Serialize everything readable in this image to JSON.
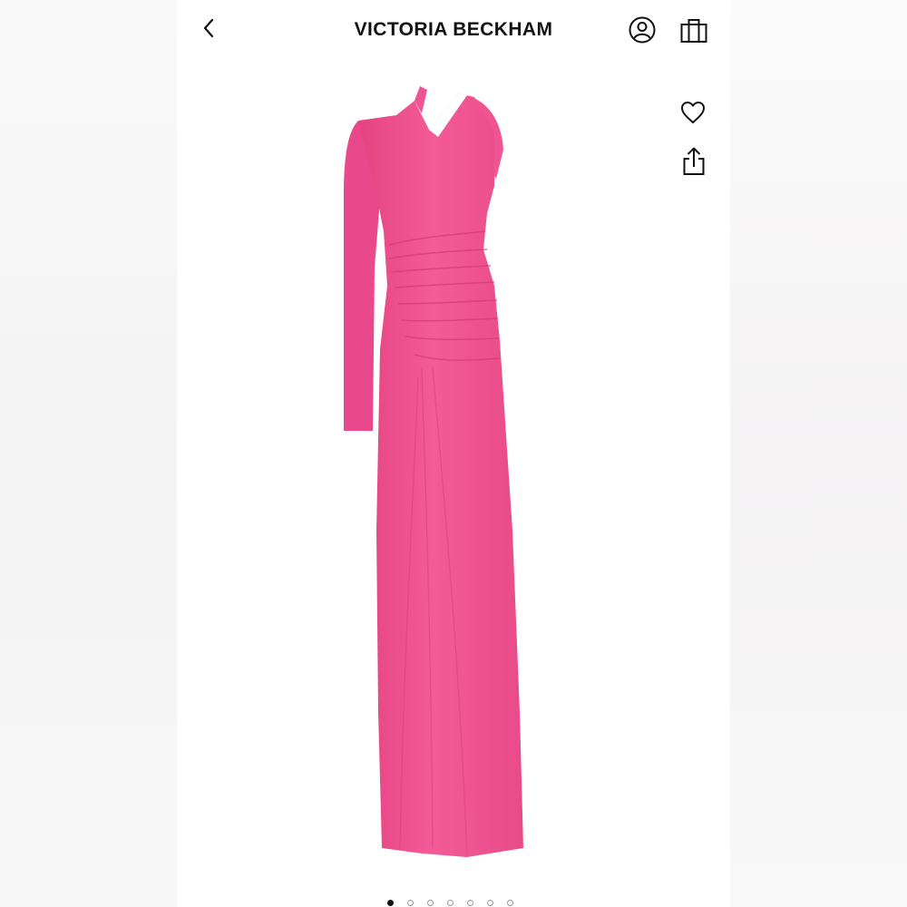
{
  "header": {
    "brand": "VICTORIA BECKHAM",
    "icons": {
      "back": "chevron-left-icon",
      "account": "user-circle-icon",
      "bag": "shopping-bag-icon"
    }
  },
  "actions": {
    "icons": {
      "favorite": "heart-icon",
      "share": "share-icon"
    }
  },
  "product": {
    "color": "#f0548f"
  },
  "carousel": {
    "total": 7,
    "active_index": 0
  }
}
